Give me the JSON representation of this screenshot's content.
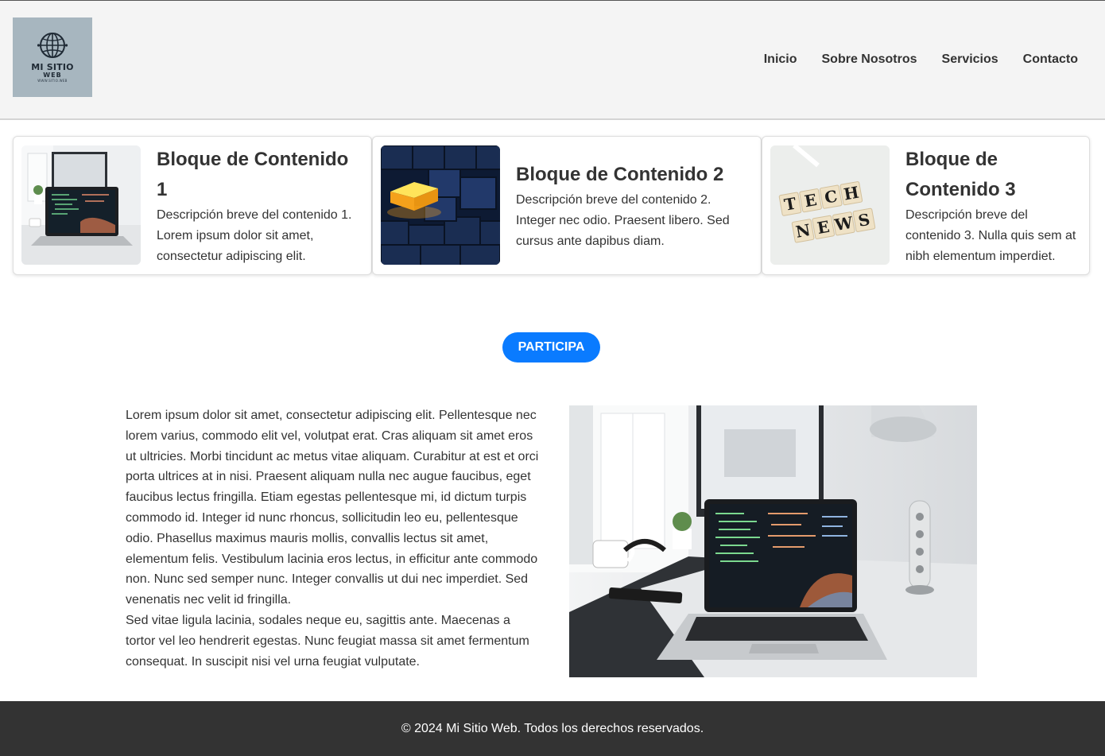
{
  "header": {
    "logo": {
      "title": "MI SITIO",
      "subtitle": "WEB",
      "tagline": "WWW.SITIO.WEB"
    },
    "nav": [
      "Inicio",
      "Sobre Nosotros",
      "Servicios",
      "Contacto"
    ]
  },
  "cards": [
    {
      "title": "Bloque de Contenido 1",
      "description": "Descripción breve del contenido 1. Lorem ipsum dolor sit amet, consectetur adipiscing elit.",
      "image": "laptop-desk-photo"
    },
    {
      "title": "Bloque de Contenido 2",
      "description": "Descripción breve del contenido 2. Integer nec odio. Praesent libero. Sed cursus ante dapibus diam.",
      "image": "abstract-cubes-photo"
    },
    {
      "title": "Bloque de Contenido 3",
      "description": "Descripción breve del contenido 3. Nulla quis sem at nibh elementum imperdiet.",
      "image": "tech-news-tiles-photo"
    }
  ],
  "cta": {
    "label": "PARTICIPA",
    "color": "#0a7bff"
  },
  "main": {
    "paragraph1": "Lorem ipsum dolor sit amet, consectetur adipiscing elit. Pellentesque nec lorem varius, commodo elit vel, volutpat erat. Cras aliquam sit amet eros ut ultricies. Morbi tincidunt ac metus vitae aliquam. Curabitur at est et orci porta ultrices at in nisi. Praesent aliquam nulla nec augue faucibus, eget faucibus lectus fringilla. Etiam egestas pellentesque mi, id dictum turpis commodo id. Integer id nunc rhoncus, sollicitudin leo eu, pellentesque odio. Phasellus maximus mauris mollis, convallis lectus sit amet, elementum felis. Vestibulum lacinia eros lectus, in efficitur ante commodo non. Nunc sed semper nunc. Integer convallis ut dui nec imperdiet. Sed venenatis nec velit id fringilla.",
    "paragraph2": "Sed vitae ligula lacinia, sodales neque eu, sagittis ante. Maecenas a tortor vel leo hendrerit egestas. Nunc feugiat massa sit amet fermentum consequat. In suscipit nisi vel urna feugiat vulputate.",
    "image": "laptop-desk-photo"
  },
  "footer": {
    "text": "© 2024 Mi Sitio Web. Todos los derechos reservados."
  },
  "colors": {
    "header_bg": "#f4f4f4",
    "footer_bg": "#333333",
    "accent": "#0a7bff",
    "text": "#333333"
  }
}
